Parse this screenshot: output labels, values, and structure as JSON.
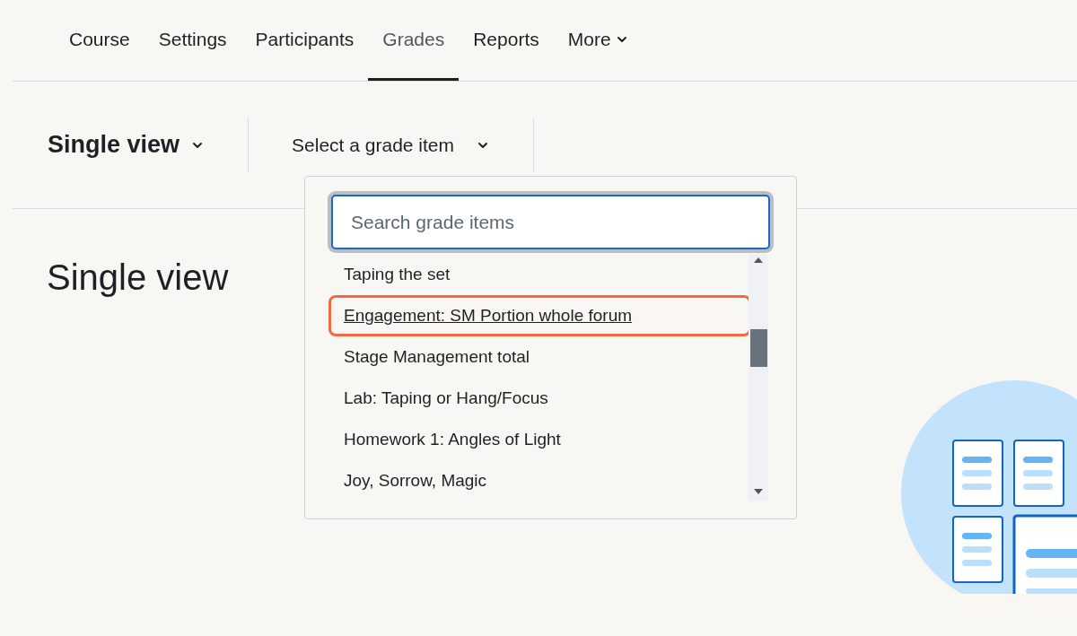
{
  "tabs": [
    {
      "label": "Course",
      "selected": false
    },
    {
      "label": "Settings",
      "selected": false
    },
    {
      "label": "Participants",
      "selected": false
    },
    {
      "label": "Grades",
      "selected": true
    },
    {
      "label": "Reports",
      "selected": false
    },
    {
      "label": "More",
      "selected": false,
      "has_menu": true
    }
  ],
  "view_select": {
    "label": "Single view"
  },
  "item_select": {
    "label": "Select a grade item"
  },
  "heading": "Single view",
  "dropdown": {
    "search": {
      "placeholder": "Search grade items"
    },
    "items": [
      {
        "label": "Taping the set",
        "highlighted": false
      },
      {
        "label": "Engagement: SM Portion whole forum",
        "highlighted": true
      },
      {
        "label": "Stage Management total",
        "highlighted": false
      },
      {
        "label": "Lab: Taping or Hang/Focus",
        "highlighted": false
      },
      {
        "label": "Homework 1: Angles of Light",
        "highlighted": false
      },
      {
        "label": "Joy, Sorrow, Magic",
        "highlighted": false
      }
    ]
  }
}
